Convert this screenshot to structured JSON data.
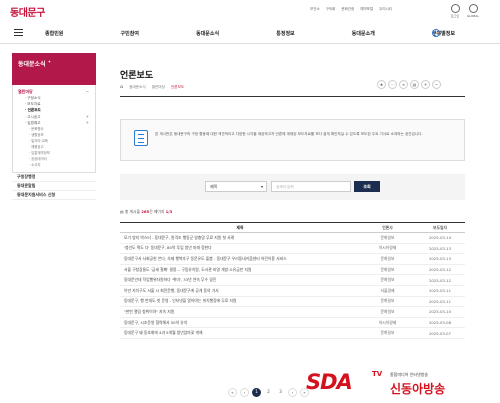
{
  "header": {
    "logo": "동대문구",
    "util_links": [
      "보건소",
      "구의회",
      "문화관광",
      "예약포털",
      "우리시티"
    ],
    "util_icons": [
      {
        "icon": "user-icon",
        "label": "로그인"
      },
      {
        "icon": "globe-icon",
        "label": "GLOBAL"
      }
    ]
  },
  "gnb": {
    "items": [
      "종합민원",
      "구민참여",
      "동대문소식",
      "통정정보",
      "동대문소개",
      "분야별정보"
    ]
  },
  "sidebar": {
    "title": "동대문소식",
    "items": [
      {
        "label": "열린마당",
        "active": true
      },
      {
        "label": "구정소식",
        "sub": true
      },
      {
        "label": "보도자료",
        "sub": true
      },
      {
        "label": "언론보도",
        "sub": true,
        "current": true
      },
      {
        "label": "고시공고",
        "sub": true,
        "plus": true
      },
      {
        "label": "입법예고",
        "sub": true,
        "plus": true
      },
      {
        "label": "문화행사",
        "sub2": true
      },
      {
        "label": "생활정보",
        "sub2": true
      },
      {
        "label": "일자리·교육",
        "sub2": true
      },
      {
        "label": "채용공고",
        "sub2": true
      },
      {
        "label": "입찰계약정보",
        "sub2": true
      },
      {
        "label": "공공데이터",
        "sub2": true
      },
      {
        "label": "소식지",
        "sub2": true
      }
    ],
    "extras": [
      "구청장행정",
      "동대문알림",
      "동대문지원서비스 신청"
    ]
  },
  "content": {
    "title": "언론보도",
    "breadcrumb": [
      "⌂",
      "동대문소식",
      "열린마당",
      "언론보도"
    ],
    "info_text": "본 게시판은 동대문구의 구정 활동에 대한 객관적이고 다양한 시각을 제공하고자 언론에 게재된 보도자료를 보다 쉽게 확인하실 수 있도록 보도된 주요 기사로 소개하는 공간입니다.",
    "search": {
      "select": "제목",
      "placeholder": "검색어 입력",
      "button": "조회"
    },
    "count": {
      "prefix": "총 게시물",
      "total": "265",
      "unit": "건",
      "page_label": "페이지",
      "page": "1/3"
    },
    "columns": [
      "제목",
      "언론사",
      "보도일자"
    ],
    "rows": [
      {
        "title": "모기 방지 박스터 - 동대문구, 원격조 행동군 방충망 무료 지원 첫 사례",
        "press": "문화일보",
        "date": "2025-03-14"
      },
      {
        "title": "'청년도 떡도 다' 동대문구, 80억 투입 청년 미래 정한다",
        "press": "아시아경제",
        "date": "2025-03-13"
      },
      {
        "title": "동대문구서 사회공헌 쓴다, 숙제 행복추구 동문유도 돌봄 - 동대문구 우리동네키움센터 어린이용 서비스",
        "press": "문화일보",
        "date": "2025-03-13"
      },
      {
        "title": "서울 구청장들도 '금세 철폐' 결정… 구립유치원, 도서관 비영 개방·소유금만 지원",
        "press": "문화일보",
        "date": "2025-03-12"
      },
      {
        "title": "동대문인데 작업행위자원하다 '취미', 33년 연속 무수 경진",
        "press": "문화일보",
        "date": "2025-03-12"
      },
      {
        "title": "이만 자치구도 서울 시 회전운행, 동대문구에 공개 동의 가사",
        "press": "서울경제",
        "date": "2025-03-11"
      },
      {
        "title": "동대문구, 행 반대도 첫 운영 - 인터넷을 알아야는 위치행정에 무료 지원",
        "press": "문화일보",
        "date": "2025-03-11"
      },
      {
        "title": "\"한번 열림 청취이야\" 지속 지원",
        "press": "문화일보",
        "date": "2025-03-10"
      },
      {
        "title": "동대문구, 시조운영 협력해서 50억 유치",
        "press": "아시아경제",
        "date": "2025-03-08"
      },
      {
        "title": "동대문구 돼 동호회에 4과 5개월 청년엄마꽃 개체",
        "press": "문화일보",
        "date": "2025-03-07"
      }
    ],
    "pagination": [
      "«",
      "‹",
      "1",
      "2",
      "3",
      "›",
      "»"
    ],
    "current_page": "1"
  },
  "watermark": {
    "brand": "SDA",
    "tv": "TV",
    "sub": "종합미디어 인터넷방송",
    "name": "신동아방송"
  },
  "colors": {
    "accent": "#b3184a",
    "navy": "#1b2e4f",
    "link": "#2c7bd6"
  }
}
